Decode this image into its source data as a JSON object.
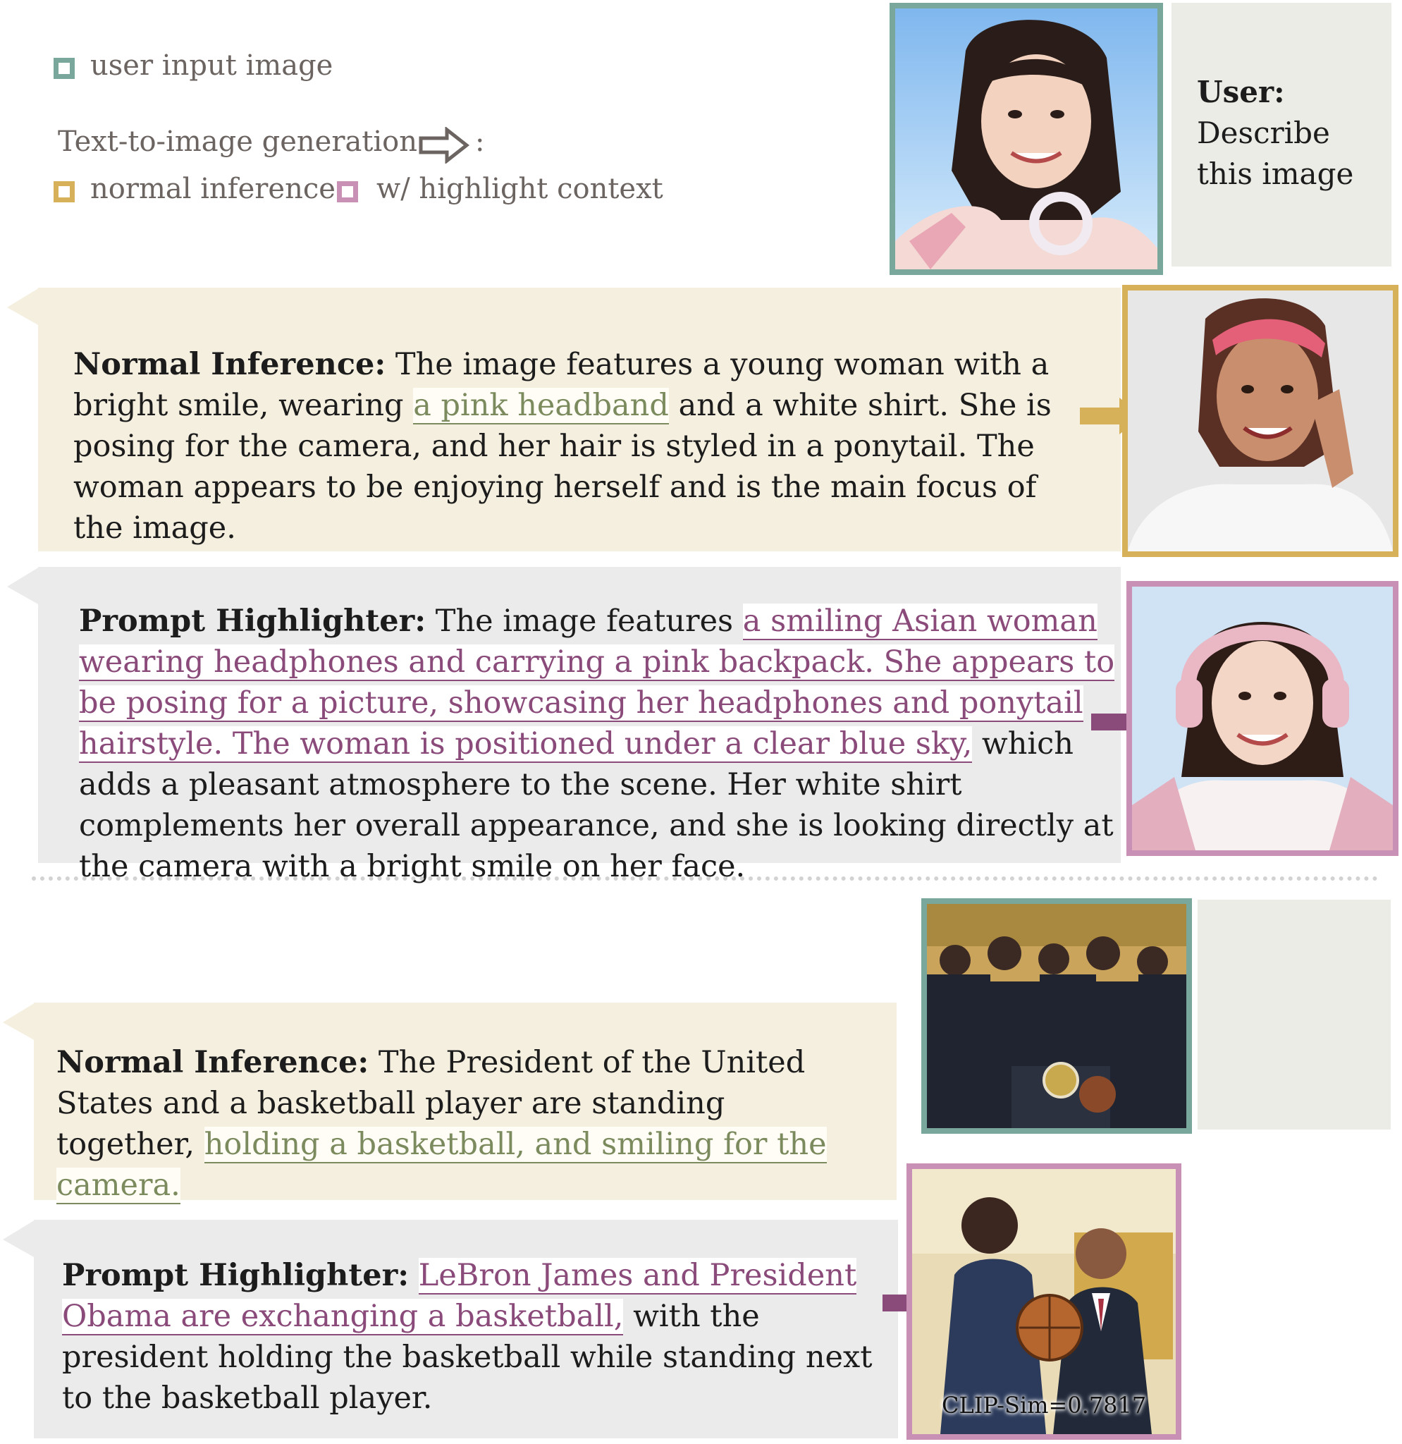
{
  "legend": {
    "user_input": "user input image",
    "t2i": "Text-to-image generation",
    "t2i_colon": ":",
    "normal": "normal inference",
    "highlight": "w/ highlight context"
  },
  "colors": {
    "user_input": "#79a79b",
    "normal": "#d7b15a",
    "highlight": "#c790b4",
    "normal_bg": "#f5efdf",
    "highlight_bg": "#ebebeb",
    "green_text": "#7c8b5e",
    "purple_text": "#8a4a7a"
  },
  "example1": {
    "user": {
      "label": "User:",
      "line1": "Describe",
      "line2": "this image"
    },
    "normal": {
      "label": "Normal Inference:",
      "t1": " The image features a young woman with a bright smile, wearing ",
      "h1": "a pink headband",
      "t2": " and a white shirt. She is posing for the camera, and her hair is styled in a ponytail. The woman appears to be enjoying herself and is the main focus of the image."
    },
    "highlight": {
      "label": "Prompt Highlighter:",
      "t1": " The image features ",
      "h1": "a smiling Asian woman wearing headphones and carrying a pink backpack. She appears to be posing for a picture, showcasing her headphones and ponytail hairstyle. The woman is positioned under a clear blue sky,",
      "t2": " which adds a pleasant atmosphere to the scene. Her white shirt complements her overall appearance, and she is looking directly at the camera with a bright smile on her face."
    },
    "images": {
      "input": "woman-photo-input",
      "normal": "woman-photo-normal",
      "highlight": "woman-photo-highlight"
    }
  },
  "example2": {
    "normal": {
      "label": "Normal Inference:",
      "t1": " The President of the United States and a basketball player are standing together, ",
      "h1": "holding a basketball, and smiling for the camera."
    },
    "highlight": {
      "label": "Prompt Highlighter:",
      "t1": " ",
      "h1": "LeBron James and President Obama are exchanging a basketball,",
      "t2": " with the president holding the basketball while standing next to the basketball player."
    },
    "clip_sim": "CLIP-Sim=0.7817",
    "images": {
      "input": "white-house-photo-input",
      "highlight": "basketball-exchange-photo"
    }
  }
}
